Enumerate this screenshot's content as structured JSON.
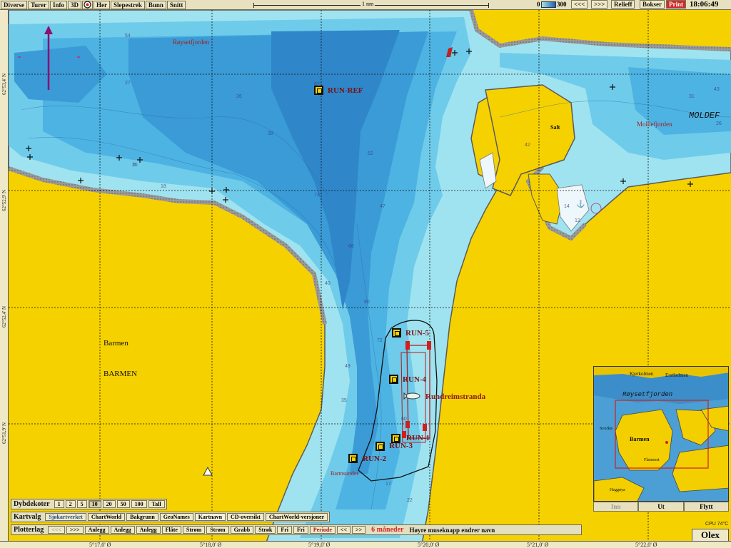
{
  "toolbar": {
    "items": [
      "Diverse",
      "Turer",
      "Info",
      "3D",
      "Her",
      "Slepestrek",
      "Bunn",
      "Snitt"
    ],
    "scale_label": "1 nm",
    "depth_scale_min": "0",
    "depth_scale_max": "300",
    "prev": "<<<",
    "next": ">>>",
    "right_items": [
      "Relieff",
      "Bokser",
      "Print"
    ],
    "clock": "18:06:49",
    "print_color": "#d12a2a"
  },
  "map": {
    "place_names": {
      "roysetfjorden": "Røysetfjorden",
      "moldefjorden_caps": "MOLDEF",
      "moldefjorden": "Moldefjorden",
      "salt": "Salt",
      "barmen": "Barmen",
      "barmen_caps": "BARMEN",
      "rundreimstranda": "Rundreimstranda",
      "barmsundet": "Barmsundet"
    },
    "runs": [
      {
        "id": "run-ref",
        "label": "RUN-REF"
      },
      {
        "id": "run-5",
        "label": "RUN-5"
      },
      {
        "id": "run-4",
        "label": "RUN-4"
      },
      {
        "id": "run-1",
        "label": "RUN-1"
      },
      {
        "id": "run-3",
        "label": "RUN-3"
      },
      {
        "id": "run-2",
        "label": "RUN-2"
      }
    ],
    "depth_soundings": [
      "54",
      "38",
      "27",
      "26",
      "25",
      "18",
      "67",
      "52",
      "47",
      "66",
      "80",
      "73",
      "72",
      "49",
      "35",
      "40",
      "60",
      "22",
      "42",
      "14",
      "12",
      "31",
      "43",
      "17",
      "5",
      "26"
    ],
    "latitudes": [
      "62°53,4' N",
      "62°52,9' N",
      "62°52,4' N",
      "62°51,9' N"
    ],
    "longitudes": [
      "5°17,0' Ø",
      "5°18,0' Ø",
      "5°19,0' Ø",
      "5°20,0' Ø",
      "5°21,0' Ø",
      "5°22,0' Ø"
    ],
    "colors": {
      "land": "#f6d100",
      "shallow": "#9fe3f0",
      "mid": "#5cc2e6",
      "deep": "#3a9bd6",
      "deepest": "#2f7fc4"
    }
  },
  "panels": {
    "depth": {
      "title": "Dybdekoter",
      "buttons": [
        "1",
        "2",
        "5",
        "10",
        "20",
        "50",
        "100",
        "Tall"
      ]
    },
    "chart": {
      "title": "Kartvalg",
      "buttons": [
        "Sjøkartverket",
        "ChartWorld",
        "Bakgrunn",
        "GeoNames",
        "Kartnavn",
        "CD-oversikt",
        "ChartWorld-versjoner"
      ]
    },
    "plotter": {
      "title": "Plotterlag",
      "prev": "<<<",
      "next": ">>>",
      "buttons": [
        "Anlegg",
        "Anlegg",
        "Anlegg",
        "Flåte",
        "Strøm",
        "Strøm",
        "Grabb",
        "Strøk",
        "Fri",
        "Fri"
      ],
      "period": "Periode",
      "nav_prev": "<<",
      "nav_next": ">>",
      "period_value": "6 måneder",
      "hint": "Høyre museknapp endrer navn"
    }
  },
  "minimap": {
    "labels": {
      "kjerkolmen": "Kjerkolmen",
      "erstholmen": "Erstholmen",
      "roysetfjorden": "Røysetfjorden",
      "barmen": "Barmen",
      "flatneset": "Flatneset",
      "svorkis": "Svorkis",
      "heggoya": "Heggøya"
    },
    "buttons": [
      "Inn",
      "Ut",
      "Flytt"
    ]
  },
  "status": {
    "cpu": "CPU 74°C",
    "brand": "Olex"
  }
}
